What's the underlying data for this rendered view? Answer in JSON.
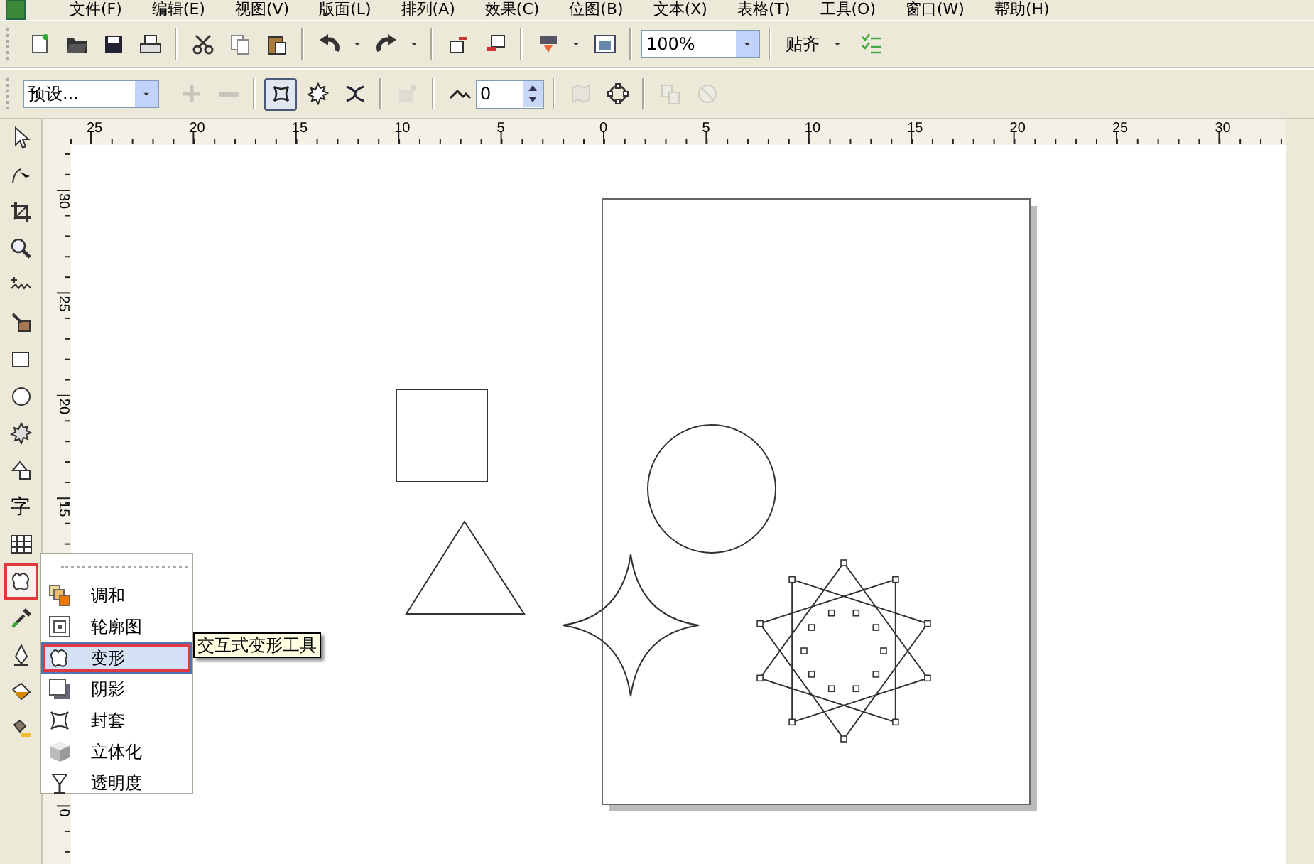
{
  "menu_bar": {
    "items": [
      "文件(F)",
      "编辑(E)",
      "视图(V)",
      "版面(L)",
      "排列(A)",
      "效果(C)",
      "位图(B)",
      "文本(X)",
      "表格(T)",
      "工具(O)",
      "窗口(W)",
      "帮助(H)"
    ]
  },
  "standard_toolbar": {
    "buttons": [
      {
        "kind": "new",
        "disabled": false
      },
      {
        "kind": "open",
        "disabled": false
      },
      {
        "kind": "save",
        "disabled": false
      },
      {
        "kind": "print",
        "disabled": false
      },
      {
        "kind": "sep"
      },
      {
        "kind": "cut",
        "disabled": false
      },
      {
        "kind": "copy",
        "disabled": false
      },
      {
        "kind": "paste",
        "disabled": false
      },
      {
        "kind": "sep"
      },
      {
        "kind": "undo",
        "disabled": false
      },
      {
        "kind": "caret",
        "disabled": false
      },
      {
        "kind": "redo",
        "disabled": false
      },
      {
        "kind": "caret",
        "disabled": false
      },
      {
        "kind": "sep"
      },
      {
        "kind": "import",
        "disabled": false
      },
      {
        "kind": "export",
        "disabled": false
      },
      {
        "kind": "sep"
      },
      {
        "kind": "publish",
        "disabled": false
      },
      {
        "kind": "caret",
        "disabled": false
      },
      {
        "kind": "app",
        "disabled": false
      }
    ],
    "zoom_level": "100%",
    "snap_label": "贴齐"
  },
  "property_bar": {
    "preset": "预设...",
    "buttons": [
      {
        "kind": "plus",
        "disabled": true,
        "selected": false
      },
      {
        "kind": "minus",
        "disabled": true,
        "selected": false
      },
      {
        "kind": "sep"
      },
      {
        "kind": "push-pull",
        "disabled": false,
        "selected": true
      },
      {
        "kind": "zipper",
        "disabled": false,
        "selected": false
      },
      {
        "kind": "twister",
        "disabled": false,
        "selected": false
      },
      {
        "kind": "sep"
      },
      {
        "kind": "copy-props",
        "disabled": true,
        "selected": false
      },
      {
        "kind": "sep"
      }
    ],
    "amplitude": "0",
    "buttons_after": [
      {
        "kind": "center",
        "disabled": true,
        "selected": false
      },
      {
        "kind": "add-new",
        "disabled": false,
        "selected": false
      },
      {
        "kind": "sep"
      },
      {
        "kind": "convert",
        "disabled": true,
        "selected": false
      },
      {
        "kind": "clear",
        "disabled": true,
        "selected": false
      }
    ]
  },
  "rulers": {
    "horizontal": [
      "25",
      "20",
      "15",
      "10",
      "5",
      "0",
      "5",
      "10",
      "15",
      "20",
      "25",
      "30"
    ],
    "vertical": [
      "30",
      "25",
      "20",
      "15",
      "0"
    ]
  },
  "toolbox": {
    "tools": [
      {
        "kind": "pick",
        "selected": false
      },
      {
        "kind": "shape",
        "selected": false
      },
      {
        "kind": "crop",
        "selected": false
      },
      {
        "kind": "zoom",
        "selected": false
      },
      {
        "kind": "freehand",
        "selected": false
      },
      {
        "kind": "smart-fill",
        "selected": false
      },
      {
        "kind": "rectangle",
        "selected": false
      },
      {
        "kind": "ellipse",
        "selected": false
      },
      {
        "kind": "polygon",
        "selected": false
      },
      {
        "kind": "basic-shapes",
        "selected": false
      },
      {
        "kind": "text",
        "label": "字",
        "selected": false
      },
      {
        "kind": "table",
        "selected": false
      },
      {
        "kind": "interactive",
        "selected": true
      },
      {
        "kind": "eyedropper",
        "selected": false
      },
      {
        "kind": "outline",
        "selected": false
      },
      {
        "kind": "fill",
        "selected": false
      },
      {
        "kind": "interactive-fill",
        "selected": false
      }
    ]
  },
  "flyout": {
    "items": [
      {
        "kind": "blend",
        "label": "调和",
        "selected": false
      },
      {
        "kind": "contour",
        "label": "轮廓图",
        "selected": false
      },
      {
        "kind": "distort",
        "label": "变形",
        "selected": true
      },
      {
        "kind": "shadow",
        "label": "阴影",
        "selected": false
      },
      {
        "kind": "envelope",
        "label": "封套",
        "selected": false
      },
      {
        "kind": "extrude",
        "label": "立体化",
        "selected": false
      },
      {
        "kind": "transparency",
        "label": "透明度",
        "selected": false
      }
    ],
    "tooltip": "交互式变形工具"
  }
}
